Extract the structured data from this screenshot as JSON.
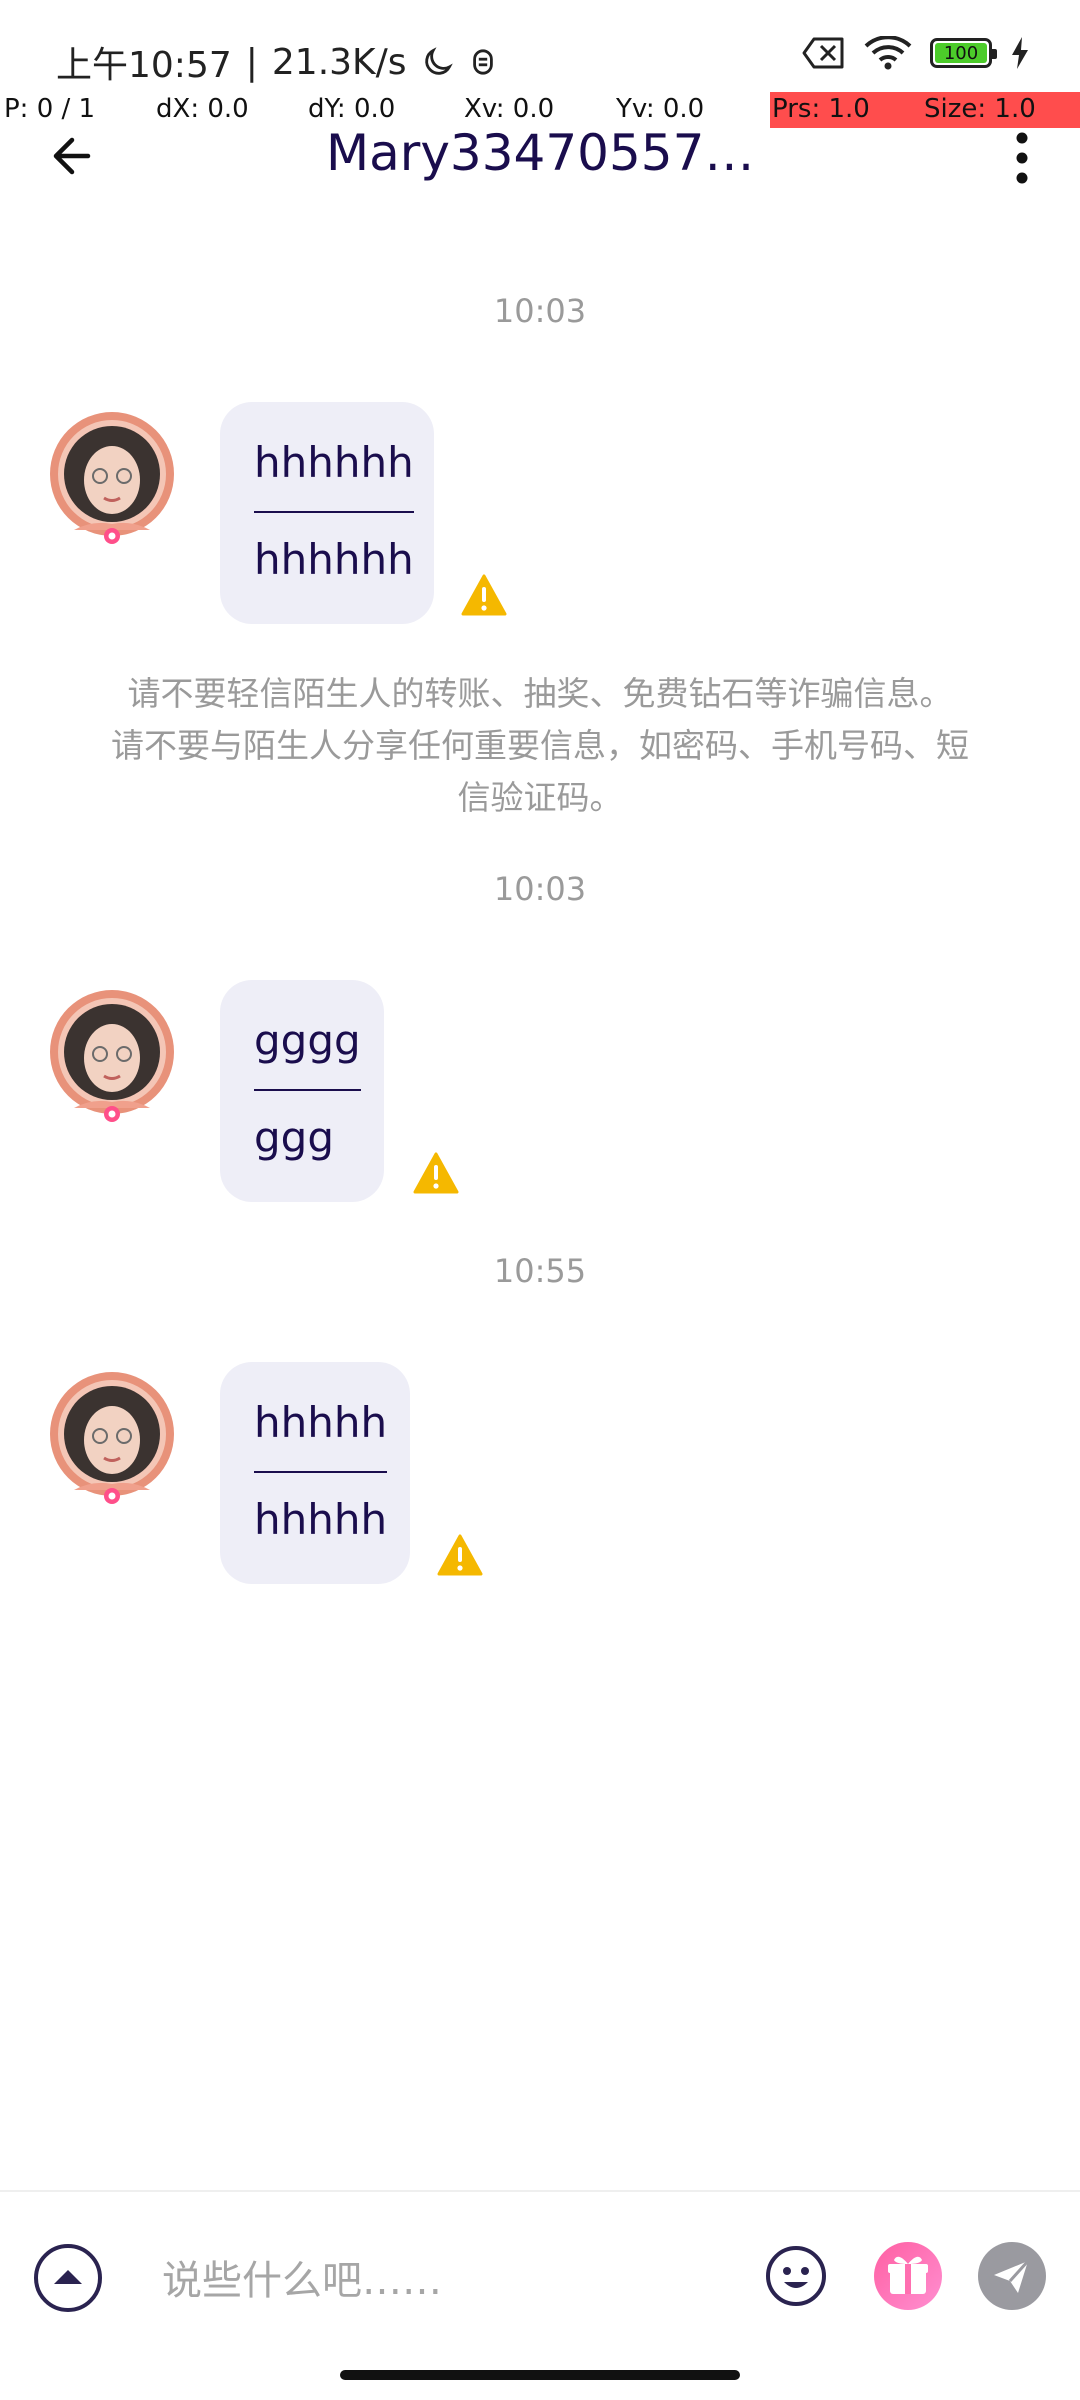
{
  "status_bar": {
    "time": "上午10:57",
    "network_speed": "21.3K/s",
    "battery_level": "100",
    "separator": "|"
  },
  "debug_overlay": {
    "pointers": "P: 0 / 1",
    "dx": "dX: 0.0",
    "dy": "dY: 0.0",
    "xv": "Xv: 0.0",
    "yv": "Yv: 0.0",
    "prs": "Prs: 1.0",
    "size": "Size: 1.0",
    "highlight_color": "#ff4d4d"
  },
  "header": {
    "title": "Mary33470557……",
    "back_icon": "arrow-left-icon",
    "more_icon": "more-vertical-icon"
  },
  "messages": [
    {
      "timestamp": "10:03",
      "line1": "hhhhhh",
      "line2": "hhhhhh"
    },
    {
      "timestamp": "10:03",
      "line1": "gggg",
      "line2": "ggg"
    },
    {
      "timestamp": "10:55",
      "line1": "hhhhh",
      "line2": "hhhhh"
    }
  ],
  "safety_notice": "请不要轻信陌生人的转账、抽奖、免费钻石等诈骗信息。 请不要与陌生人分享任何重要信息，如密码、手机号码、短信验证码。",
  "input_bar": {
    "placeholder": "说些什么吧……",
    "expand_icon": "chevron-up-circle-icon",
    "emoji_icon": "smiley-icon",
    "gift_icon": "gift-icon",
    "send_icon": "send-icon"
  },
  "colors": {
    "accent_text": "#1a0d4d",
    "bubble_bg": "#eeeef7",
    "warning": "#f5b800",
    "gift_gradient_start": "#ff5fa2",
    "gift_gradient_end": "#ff8fd1"
  }
}
